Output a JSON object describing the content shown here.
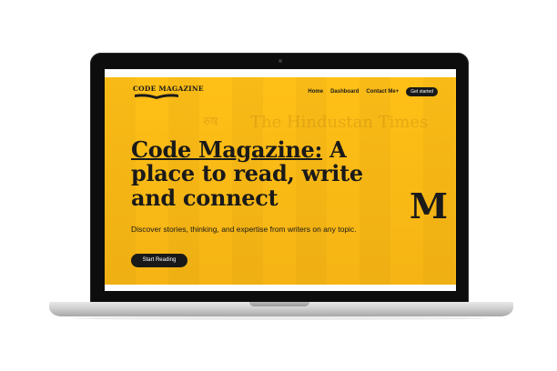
{
  "nav": {
    "logo_text": "CODE MAGAZINE",
    "links": [
      "Home",
      "Dashboard",
      "Contact Me+"
    ],
    "cta_label": "Get started"
  },
  "hero": {
    "title_highlight": "Code Magazine:",
    "title_rest": " A place to read, write and connect",
    "subtitle": "Discover stories, thinking, and expertise from writers on any topic.",
    "cta_label": "Start Reading",
    "brand_mark": "M"
  },
  "background_text": {
    "headline_left": "The Hindustan Times",
    "fragment": "रुष"
  },
  "colors": {
    "accent": "#ffc017",
    "text": "#1a1a1a",
    "button": "#191919",
    "laptop_bezel": "#0d0d0d"
  }
}
